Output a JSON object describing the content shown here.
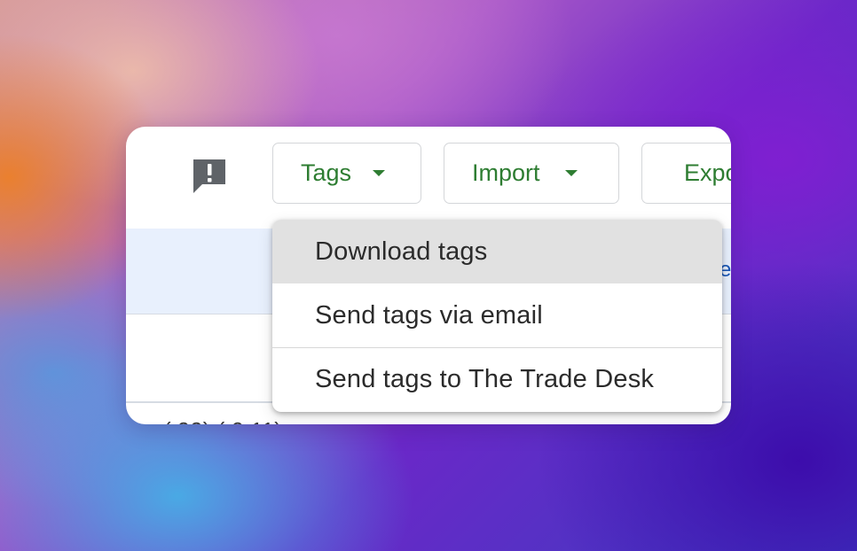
{
  "toolbar": {
    "feedback_icon": "feedback-icon",
    "tags_label": "Tags",
    "import_label": "Import",
    "export_label": "Expo"
  },
  "table": {
    "partial_header_text": "e",
    "partial_row_text": "(     99)   (     0 11)"
  },
  "tags_menu": {
    "items": [
      {
        "label": "Download tags",
        "highlighted": true
      },
      {
        "label": "Send tags via email",
        "highlighted": false
      },
      {
        "label": "Send tags to The Trade Desk",
        "highlighted": false
      }
    ]
  },
  "colors": {
    "accent_green": "#2e7d32",
    "row_highlight": "#e8f0fd",
    "menu_hover": "#e1e1e1",
    "link_blue": "#1a57b6"
  }
}
